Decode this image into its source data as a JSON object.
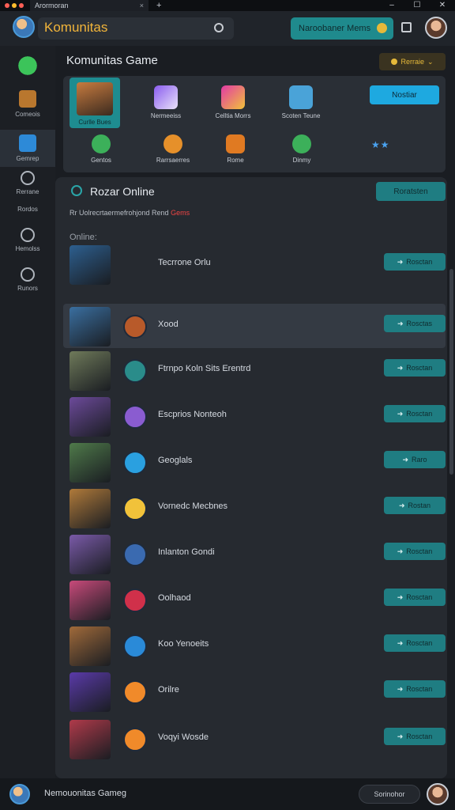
{
  "titlebar": {
    "tab_label": "Arormoran",
    "tab_close": "×",
    "new_tab": "+",
    "min": "–",
    "max": "☐",
    "close": "✕"
  },
  "header": {
    "app_title": "Komunitas",
    "action_label": "Naroobaner Mems"
  },
  "sidebar": {
    "items": [
      {
        "label": "",
        "icon": "leaf-icon"
      },
      {
        "label": "Comeois",
        "icon": "chest-icon"
      },
      {
        "label": "Gemrep",
        "icon": "shoe-icon"
      },
      {
        "label": "Rerrane",
        "icon": "gear-icon"
      },
      {
        "label": "Rordos",
        "icon": ""
      },
      {
        "label": "Hemolss",
        "icon": "info-icon"
      },
      {
        "label": "Runors",
        "icon": "alert-icon"
      }
    ]
  },
  "main": {
    "title": "Komunitas Game",
    "badge_label": "Rerraie"
  },
  "panel": {
    "tiles": [
      {
        "label": "Curlle Bues",
        "selected": true
      },
      {
        "label": "Nermeeiss"
      },
      {
        "label": "Celltia Morrs"
      },
      {
        "label": "Scoten Teune"
      },
      {
        "label": "Gentos"
      },
      {
        "label": "Rarrsaerres"
      },
      {
        "label": "Rome"
      },
      {
        "label": "Dinmy"
      }
    ],
    "button_label": "Nostiar",
    "rating": "★★"
  },
  "list": {
    "title": "Rozar Online",
    "button_label": "Roratsten",
    "subtitle": "Rr Uolrecrtaermefrohjond Rend",
    "subtitle_tag": "Gems",
    "online_label": "Online:",
    "rows": [
      {
        "name": "Tecrrone Orlu",
        "button": "Rosctan"
      },
      {
        "name": "Xood",
        "button": "Rosctas",
        "highlight": true
      },
      {
        "name": "Ftrnpo Koln Sits Erentrd",
        "button": "Rosctan"
      },
      {
        "name": "Escprios Nonteoh",
        "button": "Rosctan"
      },
      {
        "name": "Geoglals",
        "button": "Raro"
      },
      {
        "name": "Vornedc Mecbnes",
        "button": "Rostan"
      },
      {
        "name": "Inlanton Gondi",
        "button": "Rosctan"
      },
      {
        "name": "Oolhaod",
        "button": "Rosctan"
      },
      {
        "name": "Koo Yenoeits",
        "button": "Rosctan"
      },
      {
        "name": "Orilre",
        "button": "Rosctan"
      },
      {
        "name": "Voqyi Wosde",
        "button": "Rosctan"
      }
    ]
  },
  "bottombar": {
    "title": "Nemouonitas Gameg",
    "button_label": "Sorinohor"
  }
}
